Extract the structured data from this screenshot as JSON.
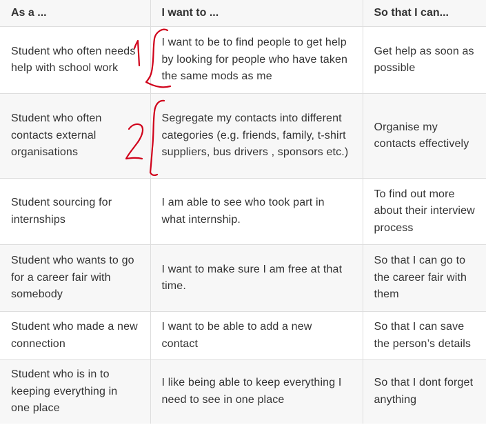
{
  "table": {
    "headers": [
      "As a ...",
      "I want to ...",
      "So that I can..."
    ],
    "rows": [
      [
        "Student who often needs help with school work",
        "I want to be to find people to get help by looking for people who have taken the same mods as me",
        "Get help as soon as possible"
      ],
      [
        "Student who often contacts external organisations",
        "Segregate my contacts into different categories (e.g. friends, family, t-shirt suppliers, bus drivers , sponsors etc.)",
        "Organise my contacts effectively"
      ],
      [
        "Student sourcing for internships",
        "I am able to see who took part in what internship.",
        "To find out more about their interview process"
      ],
      [
        "Student who wants to go for a career fair with somebody",
        "I want to make sure I am free at that time.",
        "So that I can go to the career fair with them"
      ],
      [
        "Student who made a new connection",
        "I want to be able to add a new contact",
        "So that I can save the person’s details"
      ],
      [
        "Student who is in to keeping everything in one place",
        "I like being able to keep everything I need to see in one place",
        "So that I dont forget anything"
      ]
    ]
  },
  "annotations": {
    "color": "#d0021b"
  }
}
